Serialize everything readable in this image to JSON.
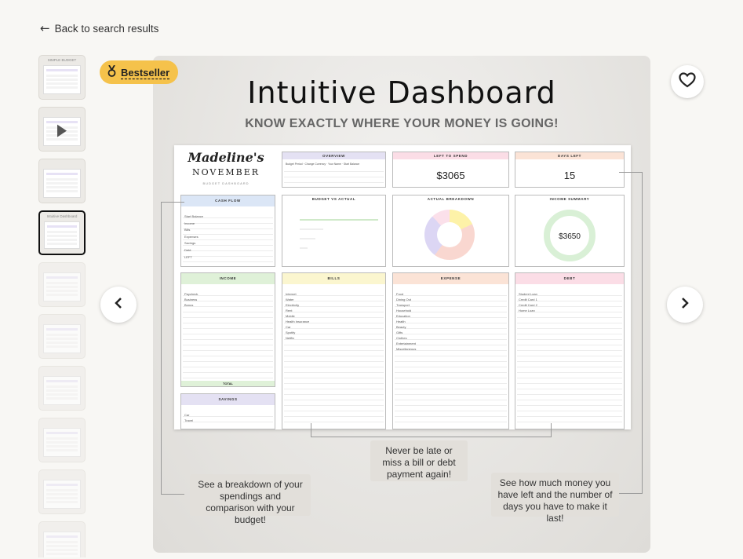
{
  "nav": {
    "back_label": "Back to search results"
  },
  "badge": {
    "label": "Bestseller"
  },
  "thumbnails": [
    {
      "label": "SIMPLE BUDGET",
      "type": "image"
    },
    {
      "label": "",
      "type": "video"
    },
    {
      "label": "",
      "type": "image"
    },
    {
      "label": "Intuitive Dashboard",
      "type": "image",
      "active": true
    },
    {
      "label": "",
      "type": "image"
    },
    {
      "label": "",
      "type": "image"
    },
    {
      "label": "",
      "type": "image"
    },
    {
      "label": "",
      "type": "image"
    },
    {
      "label": "",
      "type": "image"
    },
    {
      "label": "",
      "type": "image"
    }
  ],
  "listing_image": {
    "title": "Intuitive Dashboard",
    "subtitle": "KNOW EXACTLY WHERE YOUR MONEY IS GOING!",
    "sheet": {
      "brand_name": "Madeline's",
      "month": "NOVEMBER",
      "brand_sub": "BUDGET DASHBOARD",
      "overview_title": "OVERVIEW",
      "overview_rows": "Budget Period  ·  Change Currency  ·  Your Name  ·  Start Balance",
      "left_to_spend_title": "LEFT TO SPEND",
      "left_to_spend_value": "$3065",
      "days_left_title": "DAYS LEFT",
      "days_left_value": "15",
      "cash_flow_title": "CASH FLOW",
      "cash_flow_rows": "Start Balance\nIncome\nBills\nExpenses\nSavings\nDebt\nLEFT",
      "budget_vs_actual_title": "BUDGET VS ACTUAL",
      "actual_breakdown_title": "ACTUAL BREAKDOWN",
      "income_summary_title": "INCOME SUMMARY",
      "income_summary_value": "$3650",
      "income_title": "INCOME",
      "income_rows": "Paycheck\nBusiness\nBonus",
      "income_total_label": "TOTAL",
      "bills_title": "BILLS",
      "bills_rows": "Internet\nWater\nElectricity\nRent\nMobile\nHealth Insurance\nCar\nSpotify\nNetflix",
      "expense_title": "EXPENSE",
      "expense_rows": "Food\nDining Out\nTransport\nHousehold\nEducation\nHealth\nBeauty\nGifts\nClothes\nEntertainment\nMiscellaneous",
      "debt_title": "DEBT",
      "debt_rows": "Student Loan\nCredit Card 1\nCredit Card 2\nHome Loan",
      "savings_title": "SAVINGS",
      "savings_rows": "Car\nTravel"
    },
    "callouts": {
      "breakdown": "See a breakdown of your spendings and comparison with your budget!",
      "bills": "Never be late or miss a bill or debt payment again!",
      "left": "See how much money you have left and the number of days you have to make it last!"
    }
  },
  "colors": {
    "badge": "#f5c24b",
    "cash_flow": "#dbe6f6",
    "income": "#dff1d8",
    "bills": "#fbf6cf",
    "expense": "#fbe3d6",
    "debt": "#fbdde6",
    "overview": "#e4e1f3",
    "savings": "#e4e1f3"
  }
}
